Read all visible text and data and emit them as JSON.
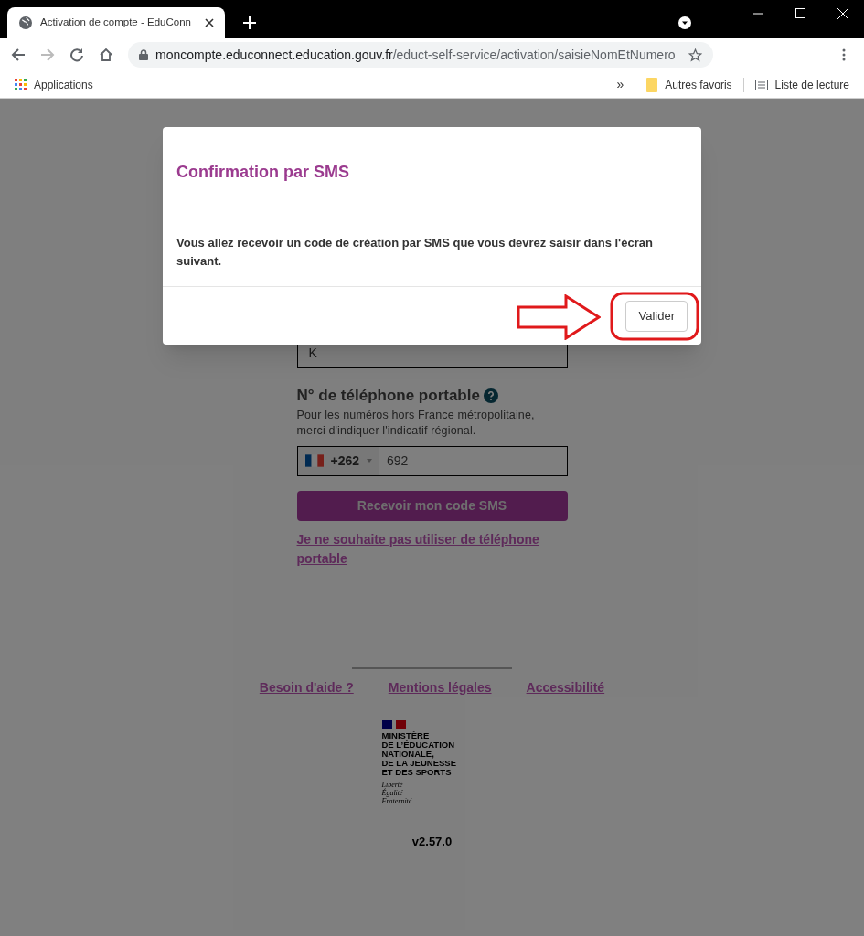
{
  "browser": {
    "tab": {
      "title": "Activation de compte - EduConn",
      "selected": true
    },
    "url_host": "moncompte.educonnect.education.gouv.fr",
    "url_path": "/educt-self-service/activation/saisieNomEtNumero",
    "bookmarks": [
      "Applications"
    ],
    "overflow": "»",
    "other_bookmarks": "Autres favoris",
    "reading_list": "Liste de lecture"
  },
  "form": {
    "name_value": "K",
    "phone_label": "N° de téléphone portable",
    "phone_help": "Pour les numéros hors France métropolitaine, merci d'indiquer l'indicatif régional.",
    "dial_code": "+262",
    "phone_value": "692",
    "submit": "Recevoir mon code SMS",
    "no_phone_link": "Je ne souhaite pas utiliser de téléphone portable"
  },
  "footer": {
    "links": [
      "Besoin d'aide ?",
      "Mentions légales",
      "Accessibilité"
    ],
    "ministry": [
      "MINISTÈRE",
      "DE L’ÉDUCATION",
      "NATIONALE,",
      "DE LA JEUNESSE",
      "ET DES SPORTS"
    ],
    "motto": [
      "Liberté",
      "Égalité",
      "Fraternité"
    ],
    "version": "v2.57.0"
  },
  "modal": {
    "title": "Confirmation par SMS",
    "message": "Vous allez recevoir un code de création par SMS que vous devrez saisir dans l'écran suivant.",
    "button": "Valider"
  }
}
